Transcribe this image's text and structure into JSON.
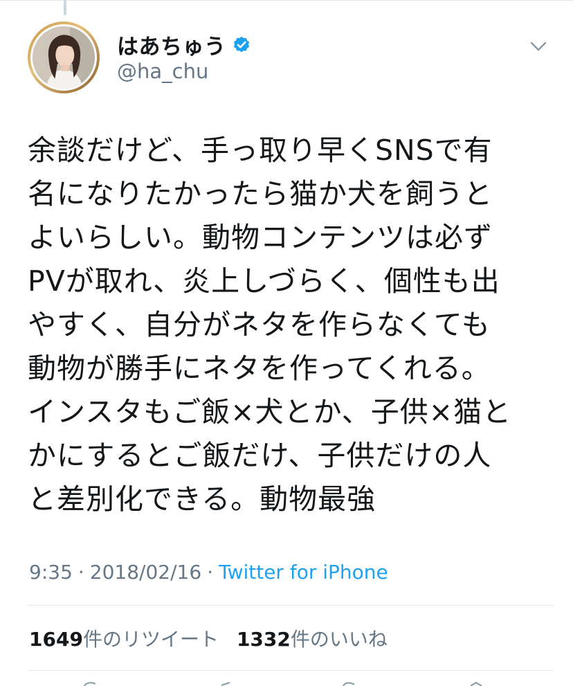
{
  "tweet": {
    "author": {
      "display_name": "はあちゅう",
      "handle": "@ha_chu",
      "verified": true
    },
    "text": "余談だけど、手っ取り早くSNSで有\n名になりたかったら猫か犬を飼うと\nよいらしい。動物コンテンツは必ず\nPVが取れ、炎上しづらく、個性も出\nやすく、自分がネタを作らなくても\n動物が勝手にネタを作ってくれる。\nインスタもご飯×犬とか、子供×猫と\nかにするとご飯だけ、子供だけの人\nと差別化できる。動物最強",
    "time": "9:35",
    "separator": "·",
    "date": "2018/02/16",
    "source": "Twitter for iPhone",
    "retweets": {
      "count": "1649",
      "label": "件のリツイート"
    },
    "likes": {
      "count": "1332",
      "label": "件のいいね"
    }
  },
  "icons": {
    "verified": "verified-badge-icon",
    "menu": "chevron-down-icon",
    "avatar": "profile-photo"
  },
  "colors": {
    "link": "#1da1f2",
    "secondary_text": "#657786",
    "primary_text": "#14171a",
    "divider": "#e1e8ed",
    "verified": "#1da1f2"
  }
}
